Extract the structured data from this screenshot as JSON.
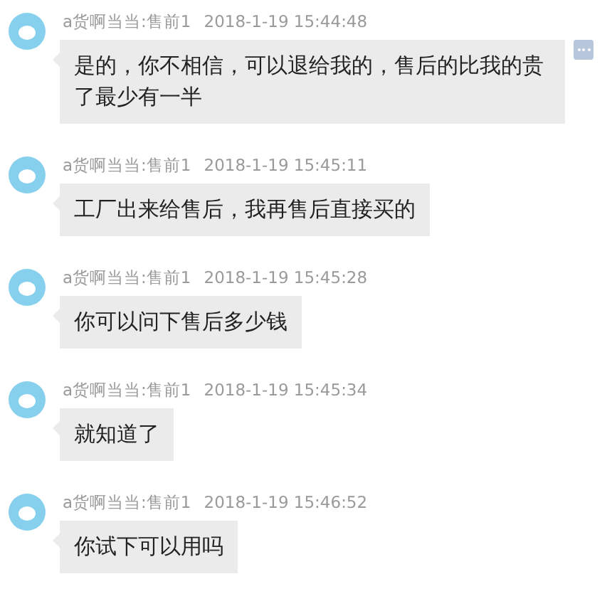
{
  "messages": [
    {
      "sender": "a货啊当当:售前1",
      "time": "2018-1-19 15:44:48",
      "text": "是的，你不相信，可以退给我的，售后的比我的贵了最少有一半",
      "has_menu": true
    },
    {
      "sender": "a货啊当当:售前1",
      "time": "2018-1-19 15:45:11",
      "text": "工厂出来给售后，我再售后直接买的",
      "has_menu": false
    },
    {
      "sender": "a货啊当当:售前1",
      "time": "2018-1-19 15:45:28",
      "text": "你可以问下售后多少钱",
      "has_menu": false
    },
    {
      "sender": "a货啊当当:售前1",
      "time": "2018-1-19 15:45:34",
      "text": "就知道了",
      "has_menu": false
    },
    {
      "sender": "a货啊当当:售前1",
      "time": "2018-1-19 15:46:52",
      "text": "你试下可以用吗",
      "has_menu": false
    }
  ]
}
